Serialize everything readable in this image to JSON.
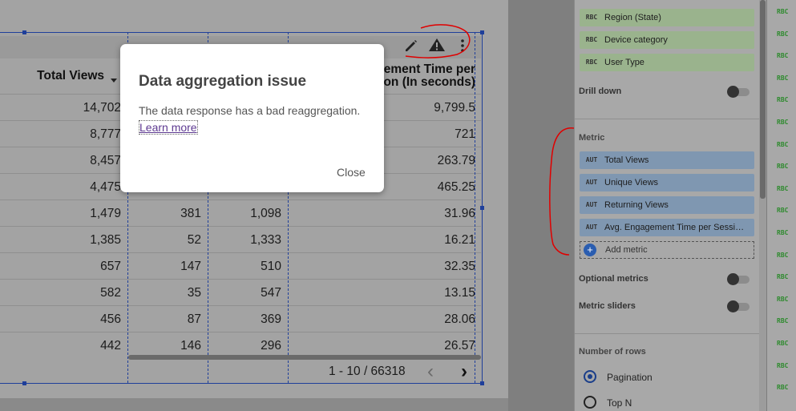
{
  "chart": {
    "toolbar_icons": [
      "pencil-icon",
      "warning-icon",
      "more-vert-icon"
    ],
    "headers": {
      "total_views": "Total Views",
      "engagement_line1": "ement Time per",
      "engagement_line2": "ion (In seconds)"
    },
    "rows": [
      {
        "c1": "14,702",
        "c2": "",
        "c3": "",
        "c4": "9,799.5"
      },
      {
        "c1": "8,777",
        "c2": "",
        "c3": "",
        "c4": "721"
      },
      {
        "c1": "8,457",
        "c2": "",
        "c3": "",
        "c4": "263.79"
      },
      {
        "c1": "4,475",
        "c2": "",
        "c3": "",
        "c4": "465.25"
      },
      {
        "c1": "1,479",
        "c2": "381",
        "c3": "1,098",
        "c4": "31.96"
      },
      {
        "c1": "1,385",
        "c2": "52",
        "c3": "1,333",
        "c4": "16.21"
      },
      {
        "c1": "657",
        "c2": "147",
        "c3": "510",
        "c4": "32.35"
      },
      {
        "c1": "582",
        "c2": "35",
        "c3": "547",
        "c4": "13.15"
      },
      {
        "c1": "456",
        "c2": "87",
        "c3": "369",
        "c4": "28.06"
      },
      {
        "c1": "442",
        "c2": "146",
        "c3": "296",
        "c4": "26.57"
      }
    ],
    "pager": {
      "range": "1 - 10 / 66318",
      "prev": "‹",
      "next": "›"
    }
  },
  "dialog": {
    "title": "Data aggregation issue",
    "message": "The data response has a bad reaggregation.",
    "link": "Learn more",
    "close": "Close"
  },
  "panel": {
    "dimensions": [
      {
        "tag": "RBC",
        "label": "Region (State)"
      },
      {
        "tag": "RBC",
        "label": "Device category"
      },
      {
        "tag": "RBC",
        "label": "User Type"
      }
    ],
    "drill_down": "Drill down",
    "metric_label": "Metric",
    "metrics": [
      {
        "tag": "AUT",
        "label": "Total Views"
      },
      {
        "tag": "AUT",
        "label": "Unique Views"
      },
      {
        "tag": "AUT",
        "label": "Returning Views"
      },
      {
        "tag": "AUT",
        "label": "Avg. Engagement Time per Session (In seconds)"
      }
    ],
    "add_metric": "Add metric",
    "optional_metrics": "Optional metrics",
    "metric_sliders": "Metric sliders",
    "number_of_rows": "Number of rows",
    "pagination": "Pagination",
    "top_n": "Top N"
  },
  "fields_tag": "RBC",
  "colors": {
    "selection": "#1f3f9a",
    "annotation": "#e00000",
    "dimension_chip": "#9ab38d",
    "metric_chip": "#7f97b1"
  }
}
